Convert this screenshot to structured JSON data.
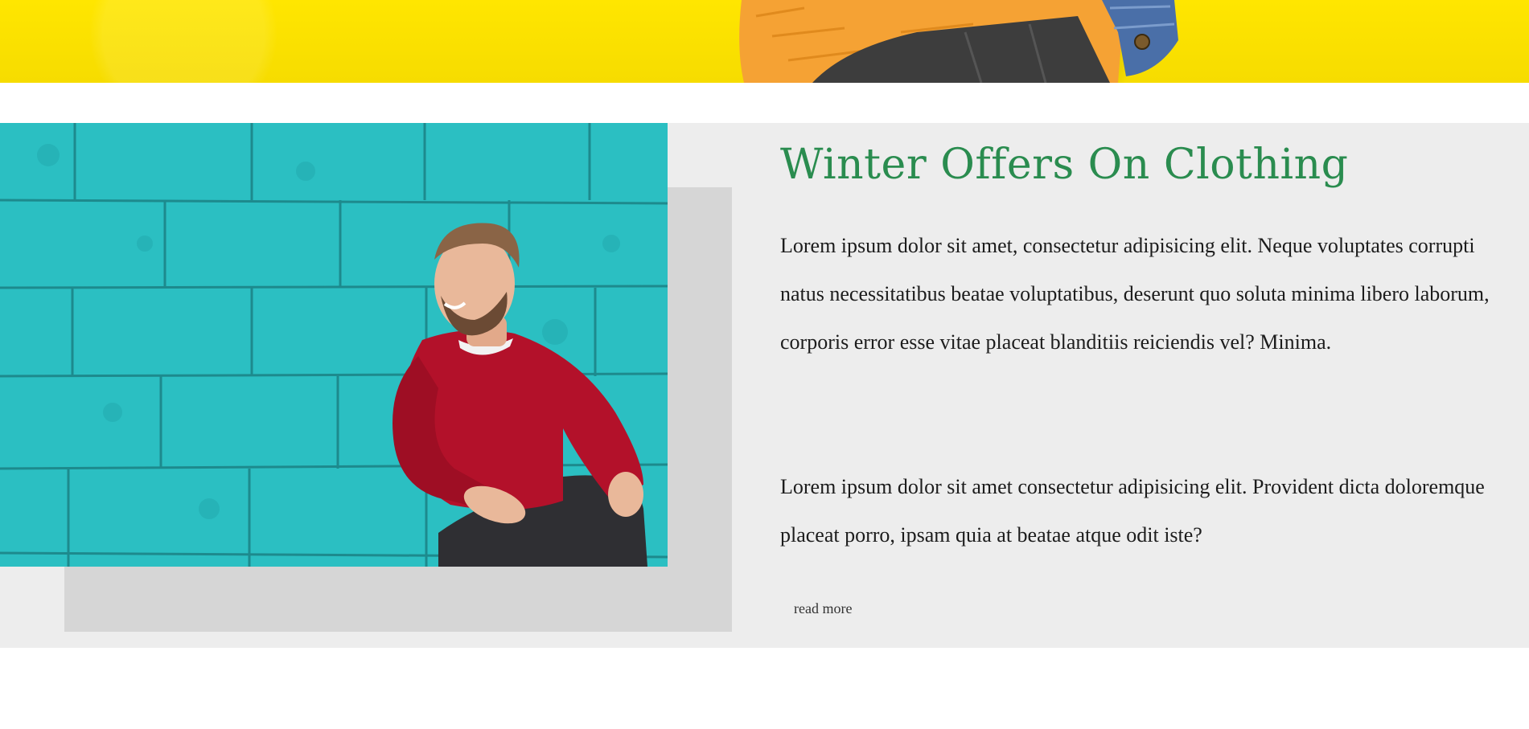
{
  "hero": {
    "image": "hero-person-orange-shirt-yellow-wall"
  },
  "offer": {
    "title": "Winter Offers On Clothing",
    "paragraph_1": "Lorem ipsum dolor sit amet, consectetur adipisicing elit. Neque voluptates corrupti natus necessitatibus beatae voluptatibus, deserunt quo soluta minima libero laborum, corporis error esse vitae placeat blanditiis reiciendis vel? Minima.",
    "paragraph_2": "Lorem ipsum dolor sit amet consectetur adipisicing elit. Provident dicta doloremque placeat porro, ipsam quia at beatae atque odit iste?",
    "read_more": "read more",
    "image": "man-red-sweater-teal-brick-wall"
  },
  "colors": {
    "title": "#2a8c4f",
    "section_bg": "#ededed",
    "shadow_block": "#d6d6d6",
    "hero_yellow": "#ffe600",
    "wall_teal": "#25c0c4",
    "sweater_red": "#b3112a"
  }
}
